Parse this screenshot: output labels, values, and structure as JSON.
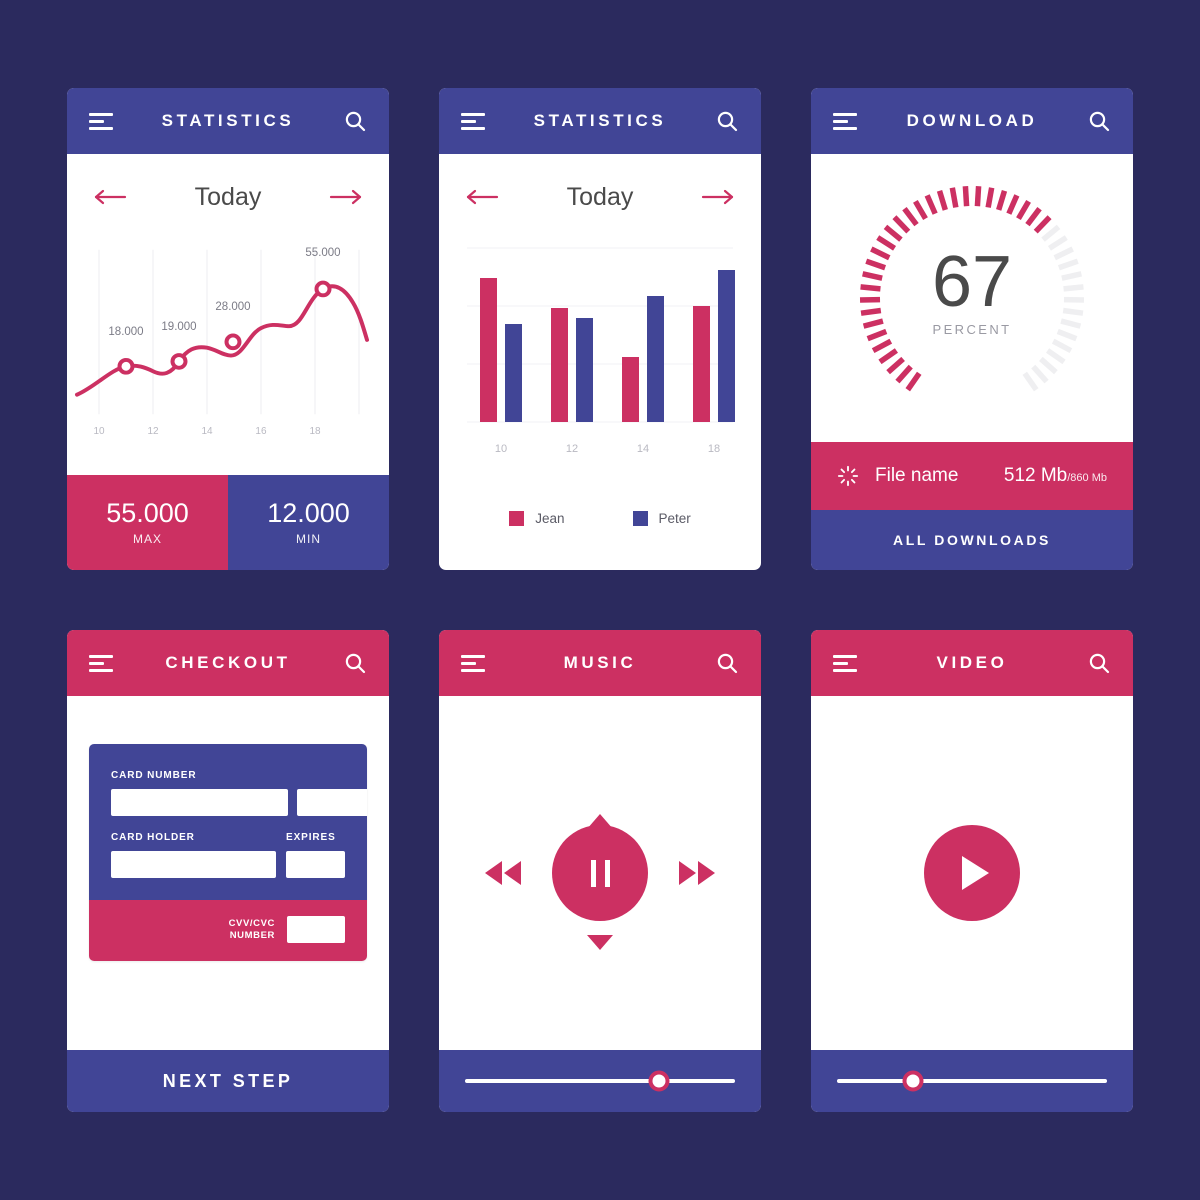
{
  "theme": {
    "background": "#2b2a5e",
    "blue": "#414596",
    "pink": "#cc3062",
    "white": "#ffffff",
    "text_dark": "#4a4a4a",
    "text_muted": "#9a9aa3",
    "gridline": "#ededf2"
  },
  "screens": {
    "statistics_line": {
      "appbar": {
        "title": "STATISTICS",
        "menu_icon": "hamburger-icon",
        "search_icon": "search-icon"
      },
      "datenav": {
        "label": "Today",
        "prev_icon": "arrow-left-icon",
        "next_icon": "arrow-right-icon"
      },
      "footer": {
        "max": {
          "value": "55.000",
          "label": "MAX"
        },
        "min": {
          "value": "12.000",
          "label": "MIN"
        }
      }
    },
    "statistics_bar": {
      "appbar": {
        "title": "STATISTICS",
        "menu_icon": "hamburger-icon",
        "search_icon": "search-icon"
      },
      "datenav": {
        "label": "Today",
        "prev_icon": "arrow-left-icon",
        "next_icon": "arrow-right-icon"
      }
    },
    "download": {
      "appbar": {
        "title": "DOWNLOAD",
        "menu_icon": "hamburger-icon",
        "search_icon": "search-icon"
      },
      "gauge": {
        "value": "67",
        "unit": "PERCENT"
      },
      "file": {
        "spinner_icon": "loading-spinner-icon",
        "name": "File name",
        "downloaded": "512 Mb",
        "total": "/860 Mb"
      },
      "all_downloads_label": "ALL DOWNLOADS"
    },
    "checkout": {
      "appbar": {
        "title": "CHECKOUT",
        "menu_icon": "hamburger-icon",
        "search_icon": "search-icon"
      },
      "card": {
        "card_number_label": "CARD NUMBER",
        "card_number_values": [
          "",
          "",
          "",
          ""
        ],
        "card_number_placeholders": [
          "",
          "",
          "",
          ""
        ],
        "card_holder_label": "CARD HOLDER",
        "card_holder_value": "",
        "expires_label": "EXPIRES",
        "expires_value": "",
        "cvv_label_line1": "CVV/CVC",
        "cvv_label_line2": "NUMBER",
        "cvv_value": ""
      },
      "next_step_label": "NEXT STEP"
    },
    "music": {
      "appbar": {
        "title": "MUSIC",
        "menu_icon": "hamburger-icon",
        "search_icon": "search-icon"
      },
      "controls": {
        "play_pause_icon": "pause-icon",
        "prev_icon": "rewind-icon",
        "next_icon": "fast-forward-icon",
        "up_icon": "triangle-up-icon",
        "down_icon": "triangle-down-icon"
      },
      "slider": {
        "position_percent": 72
      }
    },
    "video": {
      "appbar": {
        "title": "VIDEO",
        "menu_icon": "hamburger-icon",
        "search_icon": "search-icon"
      },
      "controls": {
        "play_icon": "play-icon"
      },
      "slider": {
        "position_percent": 28
      }
    }
  },
  "chart_data": [
    {
      "type": "line",
      "title": "Today",
      "xlabel": "",
      "ylabel": "",
      "x": [
        10,
        11,
        12,
        13,
        14,
        15,
        16,
        17,
        18,
        19
      ],
      "xticks": [
        "10",
        "12",
        "14",
        "16",
        "18"
      ],
      "xtick_values": [
        10,
        12,
        14,
        16,
        18
      ],
      "values": [
        8000,
        18000,
        14000,
        19000,
        16000,
        28000,
        24000,
        55000,
        46000,
        30000
      ],
      "point_labels": [
        {
          "x": 11,
          "value": 18000,
          "text": "18.000"
        },
        {
          "x": 13,
          "value": 19000,
          "text": "19.000"
        },
        {
          "x": 15,
          "value": 28000,
          "text": "28.000"
        },
        {
          "x": 17.5,
          "value": 55000,
          "text": "55.000"
        }
      ],
      "markers_at": [
        11,
        13,
        15,
        17.5
      ],
      "line_color": "#cc3062",
      "grid": true,
      "legend": "none",
      "ylim": [
        0,
        60000
      ]
    },
    {
      "type": "bar",
      "title": "Today",
      "categories": [
        "10",
        "12",
        "14",
        "18"
      ],
      "series": [
        {
          "name": "Jean",
          "color": "#cc3062",
          "values": [
            100,
            78,
            45,
            80
          ]
        },
        {
          "name": "Peter",
          "color": "#414596",
          "values": [
            66,
            73,
            90,
            102
          ]
        }
      ],
      "xlabel": "",
      "ylabel": "",
      "ylim": [
        0,
        115
      ],
      "grid": true,
      "legend": "bottom"
    },
    {
      "type": "gauge",
      "title": "DOWNLOAD",
      "value": 67,
      "max": 100,
      "unit": "PERCENT",
      "active_color": "#cc3062",
      "inactive_color": "#efeff1",
      "ticks_total": 44,
      "sweep_degrees": 290
    }
  ]
}
